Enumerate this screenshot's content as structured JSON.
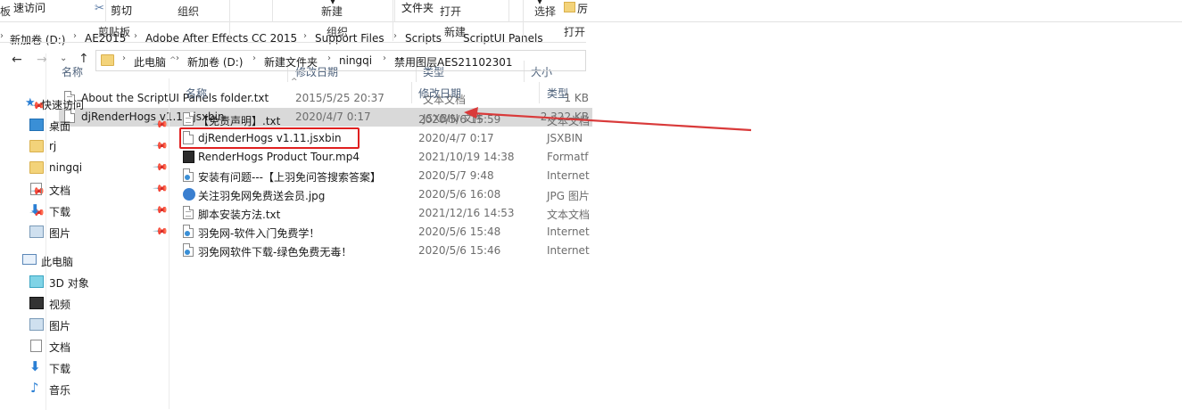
{
  "left_window": {
    "ribbon": {
      "group_1": "板",
      "group_2": "组织",
      "group_3": "新建",
      "group_4": "打开",
      "group_5": "选择"
    },
    "breadcrumb": [
      "新加卷 (D:)",
      "AE2015",
      "Adobe After Effects CC 2015",
      "Support Files",
      "Scripts",
      "ScriptUI Panels"
    ],
    "columns": {
      "name": "名称",
      "date": "修改日期",
      "type": "类型",
      "size": "大小"
    },
    "files": [
      {
        "name": "About the ScriptUI Panels folder.txt",
        "date": "2015/5/25 20:37",
        "type": "文本文档",
        "size": "1 KB"
      },
      {
        "name": "djRenderHogs v1.11.jsxbin",
        "date": "2020/4/7 0:17",
        "type": "JSXBIN 文件",
        "size": "2,322 KB"
      }
    ]
  },
  "right_window": {
    "ribbon": {
      "quick_access": "速访问",
      "cut": "剪切",
      "clipboard": "剪贴板",
      "organize": "组织",
      "new_folder": "文件夹",
      "new": "新建",
      "open": "打开",
      "properties": "厉"
    },
    "breadcrumb": [
      "此电脑",
      "新加卷 (D:)",
      "新建文件夹",
      "ningqi",
      "禁用图层AES21102301"
    ],
    "sidebar": [
      {
        "label": "快速访问",
        "icon": "star-icon",
        "pinned": false
      },
      {
        "label": "桌面",
        "icon": "desktop-icon",
        "pinned": true
      },
      {
        "label": "rj",
        "icon": "folder-icon",
        "pinned": true
      },
      {
        "label": "ningqi",
        "icon": "folder-icon",
        "pinned": true
      },
      {
        "label": "文档",
        "icon": "document-icon",
        "pinned": true
      },
      {
        "label": "下载",
        "icon": "download-icon",
        "pinned": true
      },
      {
        "label": "图片",
        "icon": "pictures-icon",
        "pinned": true
      },
      {
        "label": "此电脑",
        "icon": "computer-icon",
        "pinned": false
      },
      {
        "label": "3D 对象",
        "icon": "cube-icon",
        "pinned": false
      },
      {
        "label": "视频",
        "icon": "video-icon",
        "pinned": false
      },
      {
        "label": "图片",
        "icon": "pictures-icon",
        "pinned": false
      },
      {
        "label": "文档",
        "icon": "document-icon",
        "pinned": false
      },
      {
        "label": "下载",
        "icon": "download-icon",
        "pinned": false
      },
      {
        "label": "音乐",
        "icon": "music-icon",
        "pinned": false
      }
    ],
    "columns": {
      "name": "名称",
      "date": "修改日期",
      "type": "类型"
    },
    "files": [
      {
        "name": "【免责声明】.txt",
        "date": "2020/5/6 15:59",
        "type": "文本文档",
        "icon": "text-file-icon"
      },
      {
        "name": "djRenderHogs v1.11.jsxbin",
        "date": "2020/4/7 0:17",
        "type": "JSXBIN",
        "icon": "file-icon"
      },
      {
        "name": "RenderHogs Product Tour.mp4",
        "date": "2021/10/19 14:38",
        "type": "Formatf",
        "icon": "video-file-icon"
      },
      {
        "name": "安装有问题---【上羽免问答搜索答案】",
        "date": "2020/5/7 9:48",
        "type": "Internet",
        "icon": "internet-shortcut-icon"
      },
      {
        "name": "关注羽免网免费送会员.jpg",
        "date": "2020/5/6 16:08",
        "type": "JPG 图片",
        "icon": "image-file-icon"
      },
      {
        "name": "脚本安装方法.txt",
        "date": "2021/12/16 14:53",
        "type": "文本文档",
        "icon": "text-file-icon"
      },
      {
        "name": "羽免网-软件入门免费学！",
        "date": "2020/5/6 15:48",
        "type": "Internet",
        "icon": "internet-shortcut-icon"
      },
      {
        "name": "羽免网软件下载-绿色免费无毒！",
        "date": "2020/5/6 15:46",
        "type": "Internet",
        "icon": "internet-shortcut-icon"
      }
    ]
  },
  "annotation": {
    "highlight_color": "#e02020",
    "arrow_color": "#d93a3a"
  }
}
